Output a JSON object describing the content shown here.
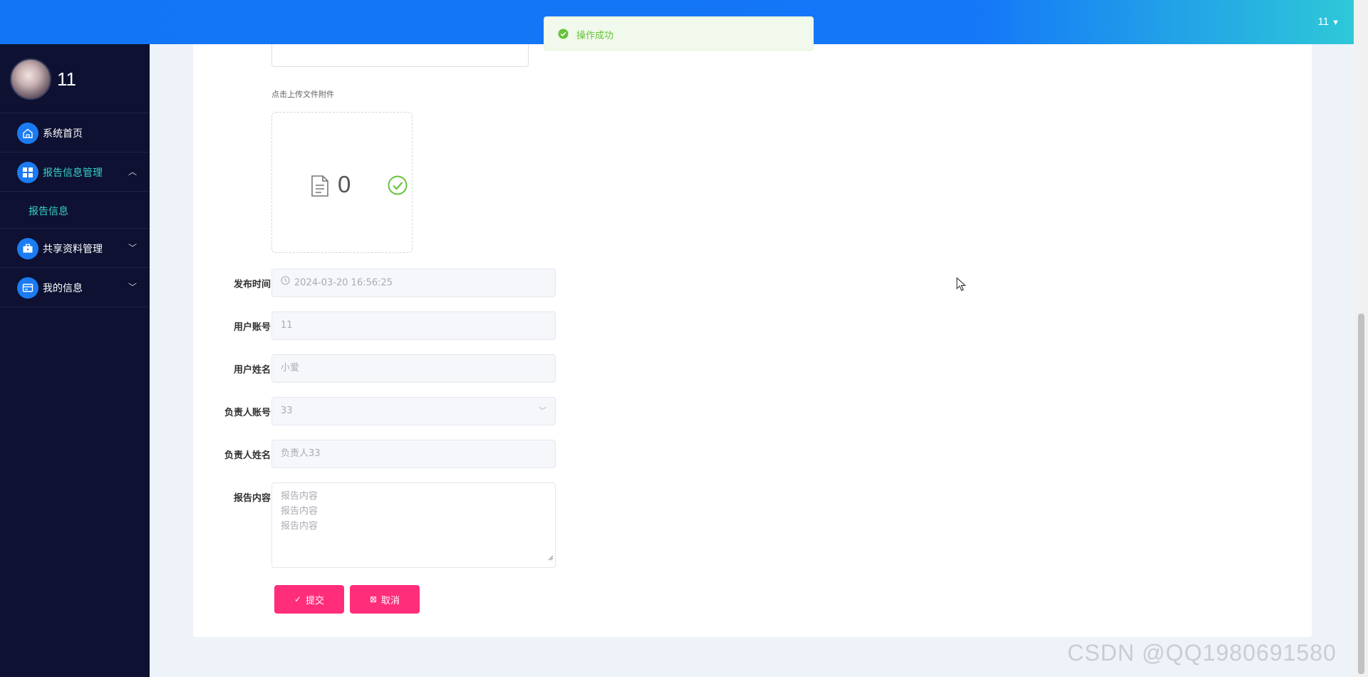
{
  "header": {
    "user_menu": "11",
    "gradient_start": "#1275f5",
    "gradient_end": "#2ec8d8"
  },
  "sidebar": {
    "profile_name": "11",
    "items": [
      {
        "label": "系统首页",
        "icon": "home-icon",
        "expanded": false
      },
      {
        "label": "报告信息管理",
        "icon": "grid-icon",
        "expanded": true,
        "children": [
          {
            "label": "报告信息"
          }
        ]
      },
      {
        "label": "共享资料管理",
        "icon": "briefcase-icon",
        "expanded": false
      },
      {
        "label": "我的信息",
        "icon": "id-card-icon",
        "expanded": false
      }
    ]
  },
  "toast": {
    "message": "操作成功",
    "type": "success"
  },
  "form": {
    "upload_hint": "点击上传文件附件",
    "upload_count": "0",
    "publish_time": {
      "label": "发布时间",
      "value": "2024-03-20 16:56:25"
    },
    "user_account": {
      "label": "用户账号",
      "value": "11"
    },
    "user_name": {
      "label": "用户姓名",
      "value": "小爱"
    },
    "manager_account": {
      "label": "负责人账号",
      "value": "33"
    },
    "manager_name": {
      "label": "负责人姓名",
      "value": "负责人33"
    },
    "report_content": {
      "label": "报告内容",
      "value": "报告内容\n报告内容\n报告内容"
    },
    "submit_label": "提交",
    "cancel_label": "取消",
    "button_color": "#ff2d7a"
  },
  "watermark": "CSDN @QQ1980691580"
}
